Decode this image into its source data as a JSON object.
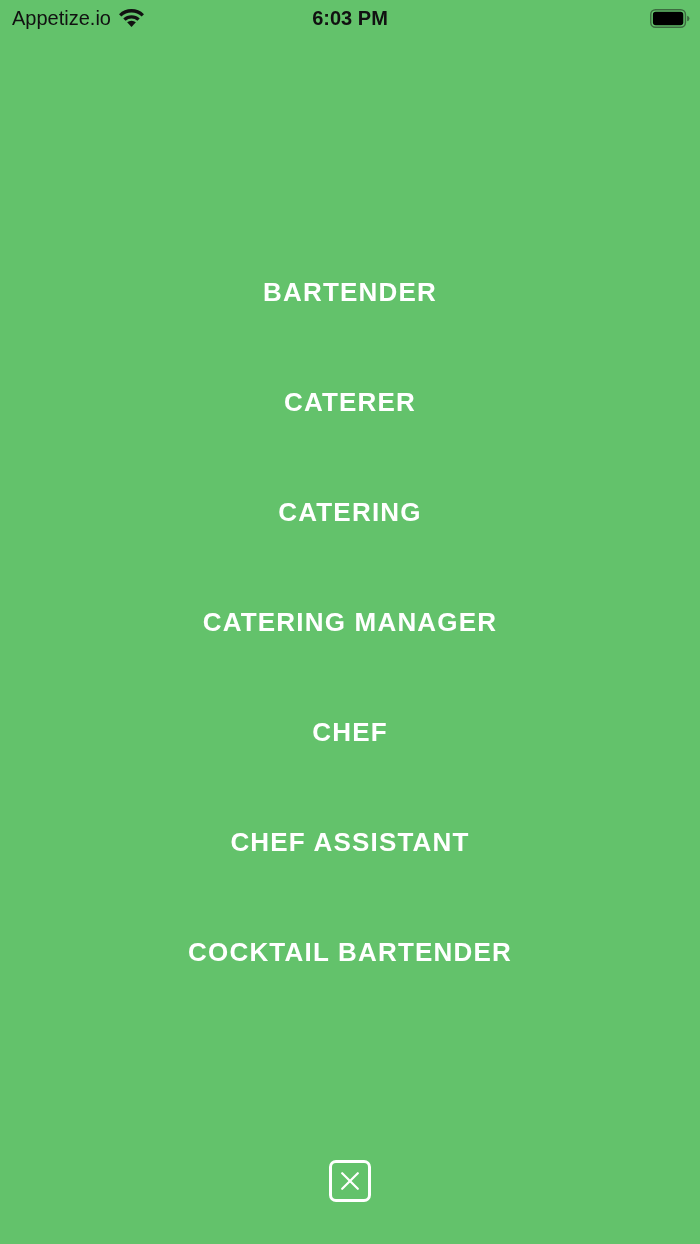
{
  "status_bar": {
    "carrier": "Appetize.io",
    "time": "6:03 PM"
  },
  "options": [
    "BARTENDER",
    "CATERER",
    "CATERING",
    "CATERING MANAGER",
    "CHEF",
    "CHEF ASSISTANT",
    "COCKTAIL BARTENDER"
  ]
}
